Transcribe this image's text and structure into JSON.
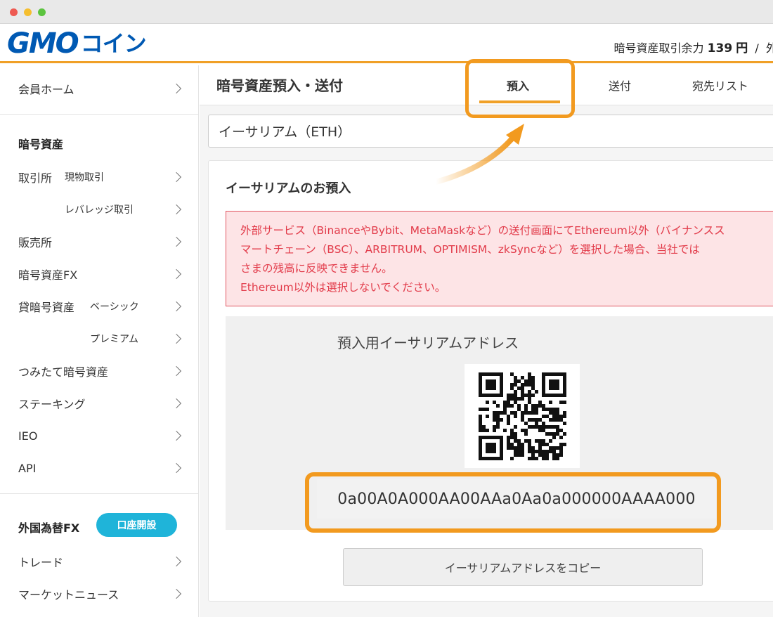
{
  "window": {
    "controls": [
      "close",
      "minimize",
      "maximize"
    ]
  },
  "header": {
    "logo_primary": "GMO",
    "logo_secondary": "コイン",
    "balance_label": "暗号資産取引余力",
    "balance_value": "139",
    "balance_unit": "円",
    "balance_separator": "/",
    "balance_more": "外"
  },
  "sidebar": {
    "home": "会員ホーム",
    "crypto_heading": "暗号資産",
    "exchange": "取引所",
    "exchange_spot": "現物取引",
    "exchange_leverage": "レバレッジ取引",
    "sales": "販売所",
    "crypto_fx": "暗号資産FX",
    "lending": "貸暗号資産",
    "lending_basic": "ベーシック",
    "lending_premium": "プレミアム",
    "tsumitate": "つみたて暗号資産",
    "staking": "ステーキング",
    "ieo": "IEO",
    "api": "API",
    "fx_heading": "外国為替FX",
    "open_account": "口座開設",
    "trade": "トレード",
    "market_news": "マーケットニュース"
  },
  "main": {
    "page_title": "暗号資産預入・送付",
    "tabs": [
      {
        "label": "預入",
        "active": true
      },
      {
        "label": "送付",
        "active": false
      },
      {
        "label": "宛先リスト",
        "active": false
      }
    ],
    "currency_select": "イーサリアム（ETH）",
    "panel_title": "イーサリアムのお預入",
    "warning_lines": [
      "外部サービス（BinanceやBybit、MetaMaskなど）の送付画面にてEthereum以外（バイナンスス",
      "マートチェーン（BSC）、ARBITRUM、OPTIMISM、zkSyncなど）を選択した場合、当社では",
      "さまの残高に反映できません。",
      "Ethereum以外は選択しないでください。"
    ],
    "address_heading": "預入用イーサリアムアドレス",
    "address": "0a00A0A000AA00AAa0Aa0a000000AAAA000",
    "copy_button": "イーサリアムアドレスをコピー"
  },
  "colors": {
    "accent_orange": "#f29a1f",
    "logo_blue": "#0059b3",
    "open_account_cyan": "#1fb4d9",
    "warning_red": "#e23b4a"
  }
}
